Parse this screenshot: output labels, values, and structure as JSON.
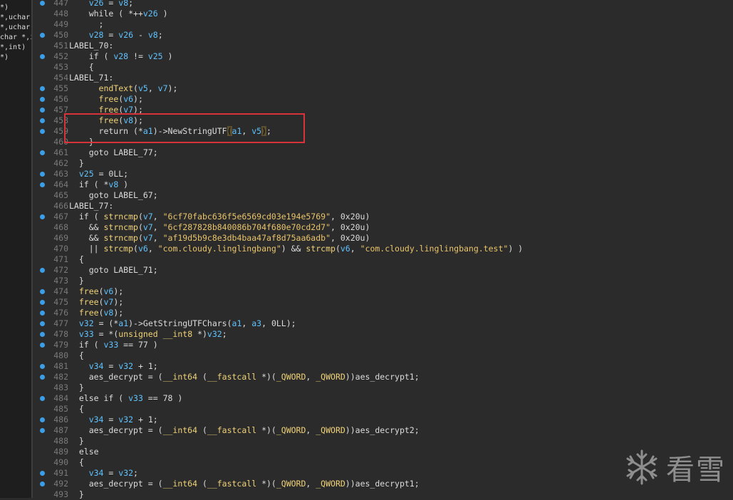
{
  "left_panel": {
    "lines": [
      "*)",
      "*,uchar",
      "*,uchar",
      "char *,i",
      "*,int)",
      "*)"
    ]
  },
  "code_lines": [
    {
      "n": "447",
      "bp": true,
      "segs": [
        [
          "    ",
          "p"
        ],
        [
          "v26",
          "v"
        ],
        [
          " = ",
          "p"
        ],
        [
          "v8",
          "v"
        ],
        [
          ";",
          "p"
        ]
      ]
    },
    {
      "n": "448",
      "bp": false,
      "segs": [
        [
          "    while ( *++",
          "p"
        ],
        [
          "v26",
          "v"
        ],
        [
          " )",
          "p"
        ]
      ]
    },
    {
      "n": "449",
      "bp": false,
      "segs": [
        [
          "      ;",
          "p"
        ]
      ]
    },
    {
      "n": "450",
      "bp": true,
      "segs": [
        [
          "    ",
          "p"
        ],
        [
          "v28",
          "v"
        ],
        [
          " = ",
          "p"
        ],
        [
          "v26",
          "v"
        ],
        [
          " - ",
          "p"
        ],
        [
          "v8",
          "v"
        ],
        [
          ";",
          "p"
        ]
      ]
    },
    {
      "n": "451",
      "bp": false,
      "segs": [
        [
          "LABEL_70:",
          "p"
        ]
      ]
    },
    {
      "n": "452",
      "bp": true,
      "segs": [
        [
          "    if ( ",
          "p"
        ],
        [
          "v28",
          "v"
        ],
        [
          " != ",
          "p"
        ],
        [
          "v25",
          "v"
        ],
        [
          " )",
          "p"
        ]
      ]
    },
    {
      "n": "453",
      "bp": false,
      "segs": [
        [
          "    {",
          "p"
        ]
      ]
    },
    {
      "n": "454",
      "bp": false,
      "segs": [
        [
          "LABEL_71:",
          "p"
        ]
      ]
    },
    {
      "n": "455",
      "bp": true,
      "segs": [
        [
          "      ",
          "p"
        ],
        [
          "endText",
          "f"
        ],
        [
          "(",
          "p"
        ],
        [
          "v5",
          "v"
        ],
        [
          ", ",
          "p"
        ],
        [
          "v7",
          "v"
        ],
        [
          ");",
          "p"
        ]
      ]
    },
    {
      "n": "456",
      "bp": true,
      "segs": [
        [
          "      ",
          "p"
        ],
        [
          "free",
          "f"
        ],
        [
          "(",
          "p"
        ],
        [
          "v6",
          "v"
        ],
        [
          ");",
          "p"
        ]
      ]
    },
    {
      "n": "457",
      "bp": true,
      "segs": [
        [
          "      ",
          "p"
        ],
        [
          "free",
          "f"
        ],
        [
          "(",
          "p"
        ],
        [
          "v7",
          "v"
        ],
        [
          ");",
          "p"
        ]
      ]
    },
    {
      "n": "458",
      "bp": true,
      "segs": [
        [
          "      ",
          "p"
        ],
        [
          "free",
          "f"
        ],
        [
          "(",
          "p"
        ],
        [
          "v8",
          "v"
        ],
        [
          ");",
          "p"
        ]
      ]
    },
    {
      "n": "459",
      "bp": true,
      "segs": [
        [
          "      return (*",
          "p"
        ],
        [
          "a1",
          "v"
        ],
        [
          ")->NewStringUTF",
          "p"
        ],
        [
          "(",
          "hl"
        ],
        [
          "a1",
          "v"
        ],
        [
          ", ",
          "p"
        ],
        [
          "v5",
          "v"
        ],
        [
          ")",
          "hl"
        ],
        [
          ";",
          "p"
        ]
      ]
    },
    {
      "n": "460",
      "bp": false,
      "segs": [
        [
          "    }",
          "p"
        ]
      ]
    },
    {
      "n": "461",
      "bp": true,
      "segs": [
        [
          "    goto LABEL_77;",
          "p"
        ]
      ]
    },
    {
      "n": "462",
      "bp": false,
      "segs": [
        [
          "  }",
          "p"
        ]
      ]
    },
    {
      "n": "463",
      "bp": true,
      "segs": [
        [
          "  ",
          "p"
        ],
        [
          "v25",
          "v"
        ],
        [
          " = 0LL;",
          "p"
        ]
      ]
    },
    {
      "n": "464",
      "bp": true,
      "segs": [
        [
          "  if ( *",
          "p"
        ],
        [
          "v8",
          "v"
        ],
        [
          " )",
          "p"
        ]
      ]
    },
    {
      "n": "465",
      "bp": false,
      "segs": [
        [
          "    goto LABEL_67;",
          "p"
        ]
      ]
    },
    {
      "n": "466",
      "bp": false,
      "segs": [
        [
          "LABEL_77:",
          "p"
        ]
      ]
    },
    {
      "n": "467",
      "bp": true,
      "segs": [
        [
          "  if ( ",
          "p"
        ],
        [
          "strncmp",
          "f"
        ],
        [
          "(",
          "p"
        ],
        [
          "v7",
          "v"
        ],
        [
          ", ",
          "p"
        ],
        [
          "\"6cf70fabc636f5e6569cd03e194e5769\"",
          "s"
        ],
        [
          ", 0x20u)",
          "p"
        ]
      ]
    },
    {
      "n": "468",
      "bp": false,
      "segs": [
        [
          "    && ",
          "p"
        ],
        [
          "strncmp",
          "f"
        ],
        [
          "(",
          "p"
        ],
        [
          "v7",
          "v"
        ],
        [
          ", ",
          "p"
        ],
        [
          "\"6cf287828b840086b704f680e70cd2d7\"",
          "s"
        ],
        [
          ", 0x20u)",
          "p"
        ]
      ]
    },
    {
      "n": "469",
      "bp": false,
      "segs": [
        [
          "    && ",
          "p"
        ],
        [
          "strncmp",
          "f"
        ],
        [
          "(",
          "p"
        ],
        [
          "v7",
          "v"
        ],
        [
          ", ",
          "p"
        ],
        [
          "\"af19d5b9c8e3db4baa47af8d75aa6adb\"",
          "s"
        ],
        [
          ", 0x20u)",
          "p"
        ]
      ]
    },
    {
      "n": "470",
      "bp": false,
      "segs": [
        [
          "    || ",
          "p"
        ],
        [
          "strcmp",
          "f"
        ],
        [
          "(",
          "p"
        ],
        [
          "v6",
          "v"
        ],
        [
          ", ",
          "p"
        ],
        [
          "\"com.cloudy.linglingbang\"",
          "s"
        ],
        [
          ") && ",
          "p"
        ],
        [
          "strcmp",
          "f"
        ],
        [
          "(",
          "p"
        ],
        [
          "v6",
          "v"
        ],
        [
          ", ",
          "p"
        ],
        [
          "\"com.cloudy.linglingbang.test\"",
          "s"
        ],
        [
          ") )",
          "p"
        ]
      ]
    },
    {
      "n": "471",
      "bp": false,
      "segs": [
        [
          "  {",
          "p"
        ]
      ]
    },
    {
      "n": "472",
      "bp": true,
      "segs": [
        [
          "    goto LABEL_71;",
          "p"
        ]
      ]
    },
    {
      "n": "473",
      "bp": false,
      "segs": [
        [
          "  }",
          "p"
        ]
      ]
    },
    {
      "n": "474",
      "bp": true,
      "segs": [
        [
          "  ",
          "p"
        ],
        [
          "free",
          "f"
        ],
        [
          "(",
          "p"
        ],
        [
          "v6",
          "v"
        ],
        [
          ");",
          "p"
        ]
      ]
    },
    {
      "n": "475",
      "bp": true,
      "segs": [
        [
          "  ",
          "p"
        ],
        [
          "free",
          "f"
        ],
        [
          "(",
          "p"
        ],
        [
          "v7",
          "v"
        ],
        [
          ");",
          "p"
        ]
      ]
    },
    {
      "n": "476",
      "bp": true,
      "segs": [
        [
          "  ",
          "p"
        ],
        [
          "free",
          "f"
        ],
        [
          "(",
          "p"
        ],
        [
          "v8",
          "v"
        ],
        [
          ");",
          "p"
        ]
      ]
    },
    {
      "n": "477",
      "bp": true,
      "segs": [
        [
          "  ",
          "p"
        ],
        [
          "v32",
          "v"
        ],
        [
          " = (*",
          "p"
        ],
        [
          "a1",
          "v"
        ],
        [
          ")->GetStringUTFChars(",
          "p"
        ],
        [
          "a1",
          "v"
        ],
        [
          ", ",
          "p"
        ],
        [
          "a3",
          "v"
        ],
        [
          ", 0LL);",
          "p"
        ]
      ]
    },
    {
      "n": "478",
      "bp": true,
      "segs": [
        [
          "  ",
          "p"
        ],
        [
          "v33",
          "v"
        ],
        [
          " = *(",
          "p"
        ],
        [
          "unsigned __int8",
          "t"
        ],
        [
          " *)",
          "p"
        ],
        [
          "v32",
          "v"
        ],
        [
          ";",
          "p"
        ]
      ]
    },
    {
      "n": "479",
      "bp": true,
      "segs": [
        [
          "  if ( ",
          "p"
        ],
        [
          "v33",
          "v"
        ],
        [
          " == 77 )",
          "p"
        ]
      ]
    },
    {
      "n": "480",
      "bp": false,
      "segs": [
        [
          "  {",
          "p"
        ]
      ]
    },
    {
      "n": "481",
      "bp": true,
      "segs": [
        [
          "    ",
          "p"
        ],
        [
          "v34",
          "v"
        ],
        [
          " = ",
          "p"
        ],
        [
          "v32",
          "v"
        ],
        [
          " + 1;",
          "p"
        ]
      ]
    },
    {
      "n": "482",
      "bp": true,
      "segs": [
        [
          "    aes_decrypt = (",
          "p"
        ],
        [
          "__int64",
          "t"
        ],
        [
          " (",
          "p"
        ],
        [
          "__fastcall",
          "t"
        ],
        [
          " *)(",
          "p"
        ],
        [
          "_QWORD",
          "t"
        ],
        [
          ", ",
          "p"
        ],
        [
          "_QWORD",
          "t"
        ],
        [
          "))aes_decrypt1;",
          "p"
        ]
      ]
    },
    {
      "n": "483",
      "bp": false,
      "segs": [
        [
          "  }",
          "p"
        ]
      ]
    },
    {
      "n": "484",
      "bp": true,
      "segs": [
        [
          "  else if ( ",
          "p"
        ],
        [
          "v33",
          "v"
        ],
        [
          " == 78 )",
          "p"
        ]
      ]
    },
    {
      "n": "485",
      "bp": false,
      "segs": [
        [
          "  {",
          "p"
        ]
      ]
    },
    {
      "n": "486",
      "bp": true,
      "segs": [
        [
          "    ",
          "p"
        ],
        [
          "v34",
          "v"
        ],
        [
          " = ",
          "p"
        ],
        [
          "v32",
          "v"
        ],
        [
          " + 1;",
          "p"
        ]
      ]
    },
    {
      "n": "487",
      "bp": true,
      "segs": [
        [
          "    aes_decrypt = (",
          "p"
        ],
        [
          "__int64",
          "t"
        ],
        [
          " (",
          "p"
        ],
        [
          "__fastcall",
          "t"
        ],
        [
          " *)(",
          "p"
        ],
        [
          "_QWORD",
          "t"
        ],
        [
          ", ",
          "p"
        ],
        [
          "_QWORD",
          "t"
        ],
        [
          "))aes_decrypt2;",
          "p"
        ]
      ]
    },
    {
      "n": "488",
      "bp": false,
      "segs": [
        [
          "  }",
          "p"
        ]
      ]
    },
    {
      "n": "489",
      "bp": false,
      "segs": [
        [
          "  else",
          "p"
        ]
      ]
    },
    {
      "n": "490",
      "bp": false,
      "segs": [
        [
          "  {",
          "p"
        ]
      ]
    },
    {
      "n": "491",
      "bp": true,
      "segs": [
        [
          "    ",
          "p"
        ],
        [
          "v34",
          "v"
        ],
        [
          " = ",
          "p"
        ],
        [
          "v32",
          "v"
        ],
        [
          ";",
          "p"
        ]
      ]
    },
    {
      "n": "492",
      "bp": true,
      "segs": [
        [
          "    aes_decrypt = (",
          "p"
        ],
        [
          "__int64",
          "t"
        ],
        [
          " (",
          "p"
        ],
        [
          "__fastcall",
          "t"
        ],
        [
          " *)(",
          "p"
        ],
        [
          "_QWORD",
          "t"
        ],
        [
          ", ",
          "p"
        ],
        [
          "_QWORD",
          "t"
        ],
        [
          "))aes_decrypt1;",
          "p"
        ]
      ]
    },
    {
      "n": "493",
      "bp": false,
      "segs": [
        [
          "  }",
          "p"
        ]
      ]
    }
  ],
  "watermark": {
    "text": "看雪",
    "icon": "snowflake-icon"
  },
  "colors": {
    "background": "#2b2b2b",
    "highlight": "#d8333a",
    "variable": "#5fc3ff",
    "function": "#f0d278"
  }
}
